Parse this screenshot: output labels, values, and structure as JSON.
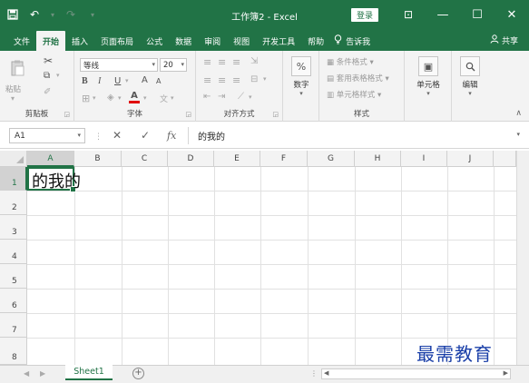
{
  "window": {
    "title": "工作簿2 - Excel",
    "login_label": "登录",
    "qat_icons": [
      "save-icon",
      "undo-icon",
      "redo-icon",
      "customize-icon"
    ],
    "controls": {
      "ribbon_options": "⊡",
      "minimize": "—",
      "restore": "☐",
      "close": "✕"
    }
  },
  "menu": {
    "items": [
      "文件",
      "开始",
      "插入",
      "页面布局",
      "公式",
      "数据",
      "审阅",
      "视图",
      "开发工具",
      "帮助"
    ],
    "active_index": 1,
    "tell_me": "告诉我",
    "share": "共享"
  },
  "ribbon": {
    "clipboard": {
      "label": "剪贴板",
      "paste": "粘贴"
    },
    "font": {
      "label": "字体",
      "name": "等线",
      "size": "20",
      "bold": "B",
      "italic": "I",
      "underline": "U",
      "grow": "A",
      "shrink": "A",
      "font_color_letter": "A",
      "phonetic": "文"
    },
    "alignment": {
      "label": "对齐方式"
    },
    "number": {
      "label": "数字",
      "percent": "%"
    },
    "styles": {
      "label": "样式",
      "conditional": "条件格式",
      "table": "套用表格格式",
      "cell": "单元格样式"
    },
    "cells": {
      "label": "单元格"
    },
    "editing": {
      "label": "编辑"
    }
  },
  "formula_bar": {
    "name_box": "A1",
    "fx": "fx",
    "content": "的我的"
  },
  "grid": {
    "columns": [
      "A",
      "B",
      "C",
      "D",
      "E",
      "F",
      "G",
      "H",
      "I",
      "J"
    ],
    "rows": [
      "1",
      "2",
      "3",
      "4",
      "5",
      "6",
      "7",
      "8"
    ],
    "selected_cell": "A1",
    "cells": {
      "A1": "的我的"
    }
  },
  "sheets": {
    "tabs": [
      "Sheet1"
    ],
    "active": "Sheet1"
  },
  "colors": {
    "brand": "#217346",
    "ribbon_bg": "#f3f3f3"
  },
  "watermark": "最需教育"
}
